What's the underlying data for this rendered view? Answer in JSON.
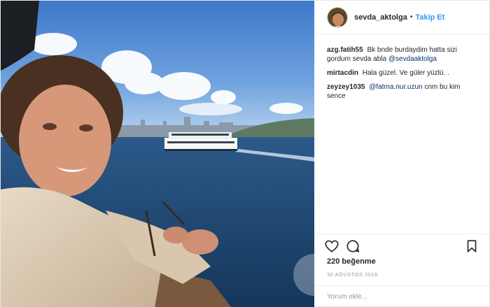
{
  "post": {
    "username": "sevda_aktolga",
    "separator": "•",
    "follow_label": "Takip Et",
    "comments": [
      {
        "author": "azg.fatih55",
        "text": "Bk bnde burdaydim hatta sizi gordum sevda abla",
        "mention": "@sevdaaktolga"
      },
      {
        "author": "mirtacdin",
        "text": "Hala güzel. Ve güler yüzlü. .",
        "mention": ""
      },
      {
        "author": "zeyzey1035",
        "text": "",
        "mention": "@fatma.nur.uzun",
        "text_after": " cnm bu kim sence"
      }
    ],
    "likes_label": "220 beğenme",
    "date_label": "30 AĞUSTOS 2016",
    "add_comment_placeholder": "Yorum ekle...",
    "icons": {
      "like": "heart-icon",
      "comment": "comment-icon",
      "save": "bookmark-icon"
    }
  },
  "colors": {
    "link_blue": "#3897f0",
    "mention_blue": "#003569",
    "text": "#262626",
    "muted": "#999999",
    "border": "#efefef"
  }
}
